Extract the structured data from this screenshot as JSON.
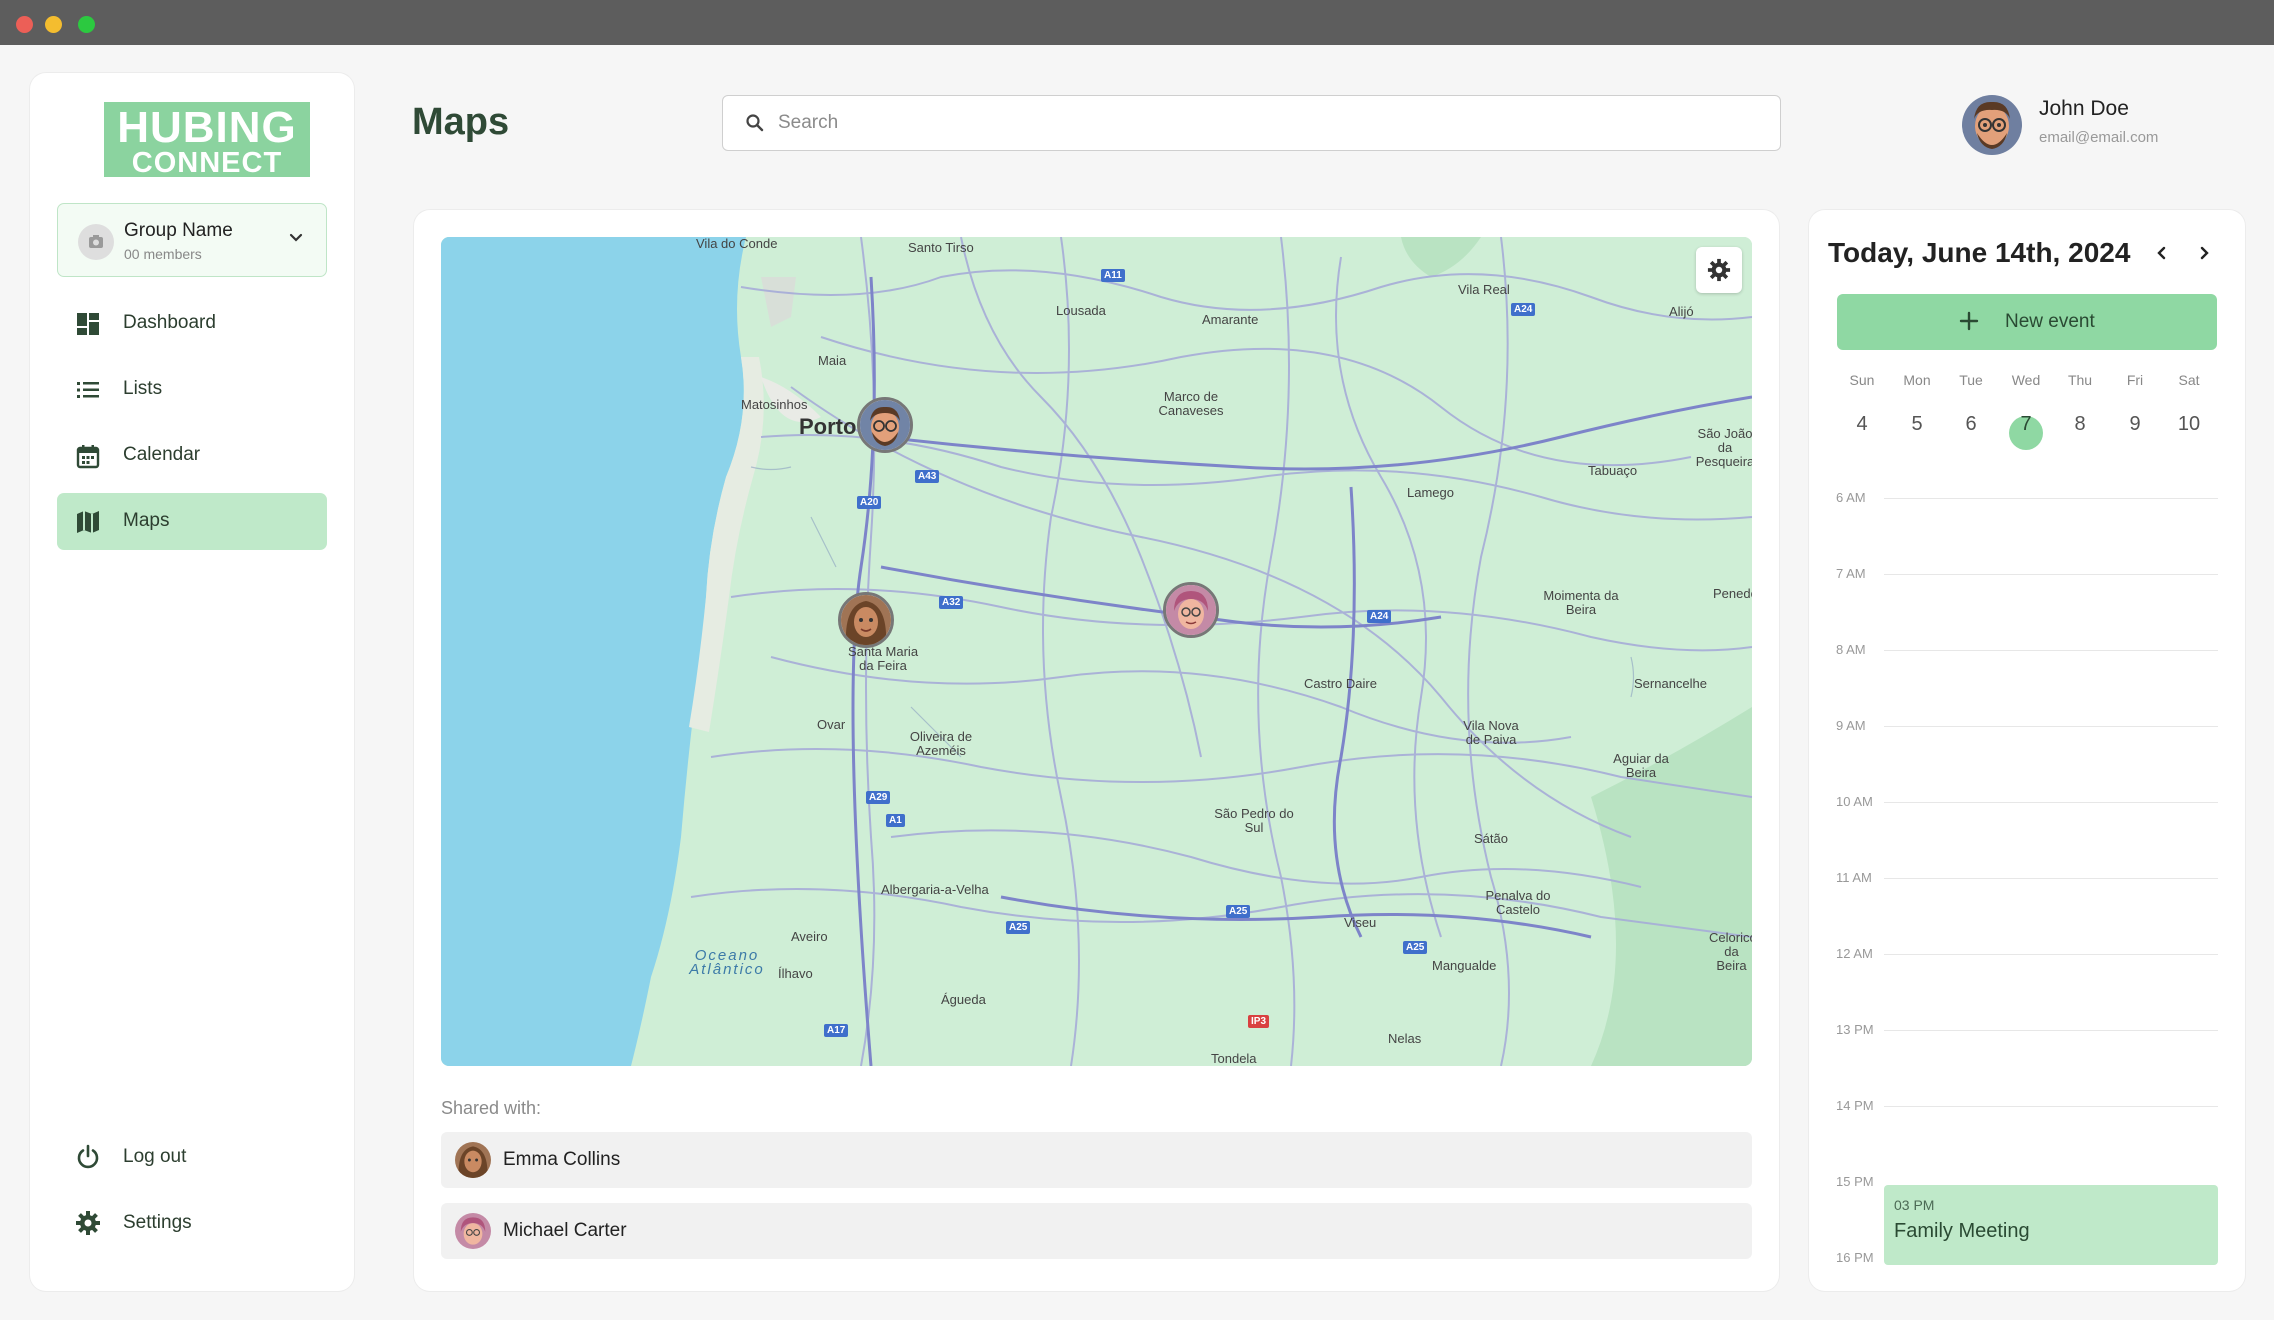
{
  "app": {
    "logo_line1": "HUBING",
    "logo_line2": "CONNECT",
    "accent": "#8fd8a3",
    "accent_dark": "#2f4a36"
  },
  "sidebar": {
    "group": {
      "name": "Group Name",
      "members": "00 members"
    },
    "items": [
      {
        "label": "Dashboard",
        "icon": "dashboard-icon",
        "active": false
      },
      {
        "label": "Lists",
        "icon": "list-icon",
        "active": false
      },
      {
        "label": "Calendar",
        "icon": "calendar-icon",
        "active": false
      },
      {
        "label": "Maps",
        "icon": "map-icon",
        "active": true
      }
    ],
    "bottom": [
      {
        "label": "Log out",
        "icon": "power-icon"
      },
      {
        "label": "Settings",
        "icon": "gear-icon"
      }
    ]
  },
  "header": {
    "title": "Maps",
    "search_placeholder": "Search",
    "user": {
      "name": "John Doe",
      "email": "email@email.com"
    }
  },
  "map": {
    "places": [
      "Vila do Conde",
      "Santo Tirso",
      "Vila Real",
      "Alijó",
      "Lousada",
      "Amarante",
      "Maia",
      "Matosinhos",
      "Porto",
      "Marco de Canaveses",
      "São João da Pesqueira",
      "Tabuaço",
      "Lamego",
      "Moimenta da Beira",
      "Penedono",
      "Santa Maria da Feira",
      "Castro Daire",
      "Sernancelhe",
      "Ovar",
      "Oliveira de Azeméis",
      "Vila Nova de Paiva",
      "Aguiar da Beira",
      "São Pedro do Sul",
      "Sátão",
      "Albergaria-a-Velha",
      "Penalva do Castelo",
      "Viseu",
      "Celorico da Beira",
      "Oceano Atlântico",
      "Aveiro",
      "Mangualde",
      "Ílhavo",
      "Águeda",
      "Nelas",
      "Tondela"
    ],
    "roads": [
      "A11",
      "A24",
      "A43",
      "A20",
      "A32",
      "A24",
      "A29",
      "A1",
      "A25",
      "A25",
      "A25",
      "A17",
      "IP3"
    ]
  },
  "shared": {
    "label": "Shared with:",
    "people": [
      {
        "name": "Emma Collins"
      },
      {
        "name": "Michael Carter"
      }
    ]
  },
  "calendar": {
    "title": "Today, June 14th, 2024",
    "new_event_label": "New event",
    "week_headers": [
      "Sun",
      "Mon",
      "Tue",
      "Wed",
      "Thu",
      "Fri",
      "Sat"
    ],
    "week_days": [
      "4",
      "5",
      "6",
      "7",
      "8",
      "9",
      "10"
    ],
    "selected_day": "7",
    "hours": [
      "6 AM",
      "7 AM",
      "8 AM",
      "9 AM",
      "10 AM",
      "11 AM",
      "12 AM",
      "13 PM",
      "14 PM",
      "15 PM",
      "16 PM"
    ],
    "event": {
      "time": "03 PM",
      "name": "Family Meeting"
    }
  }
}
